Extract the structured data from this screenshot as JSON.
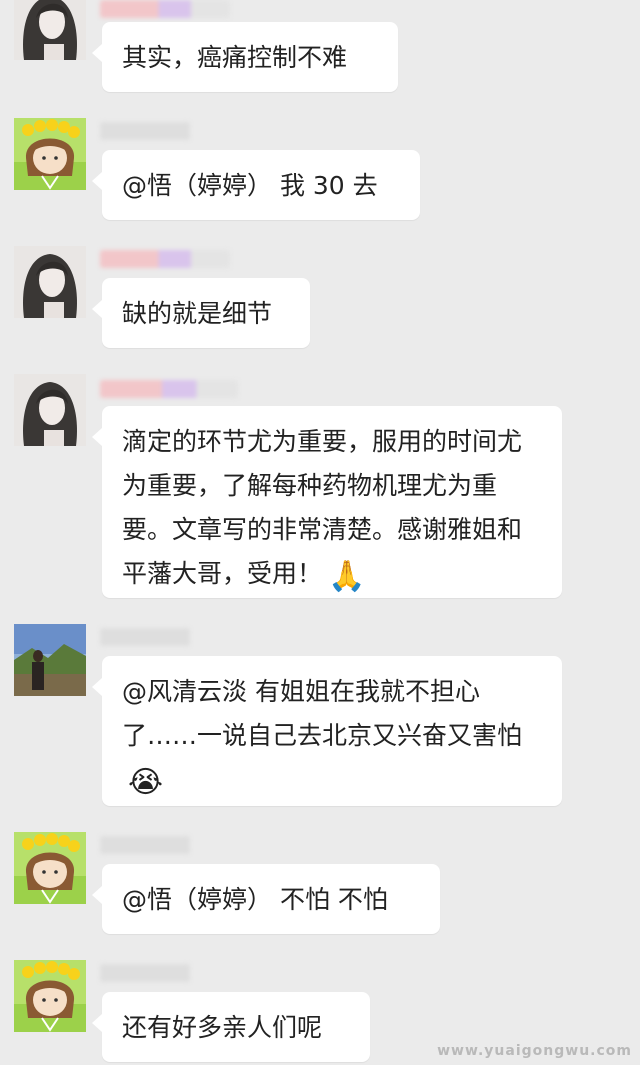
{
  "messages": [
    {
      "sender": "woman",
      "text": "其实，癌痛控制不难"
    },
    {
      "sender": "girl",
      "text": "@悟（婷婷） 我 30 去"
    },
    {
      "sender": "woman",
      "text": "缺的就是细节"
    },
    {
      "sender": "woman",
      "text": "滴定的环节尤为重要，服用的时间尤为重要，了解每种药物机理尤为重要。文章写的非常清楚。感谢雅姐和平藩大哥，受用！",
      "emoji": "🙏"
    },
    {
      "sender": "landscape",
      "text": "@风清云淡  有姐姐在我就不担心了……一说自己去北京又兴奋又害怕",
      "emoji": "😭"
    },
    {
      "sender": "girl",
      "text": "@悟（婷婷） 不怕 不怕"
    },
    {
      "sender": "girl",
      "text": "还有好多亲人们呢"
    }
  ],
  "watermark": "www.yuaigongwu.com",
  "colors": {
    "background": "#ebebeb",
    "bubble": "#ffffff",
    "text": "#222222"
  },
  "icons": [
    "woman-avatar-icon",
    "girl-avatar-icon",
    "landscape-avatar-icon"
  ]
}
